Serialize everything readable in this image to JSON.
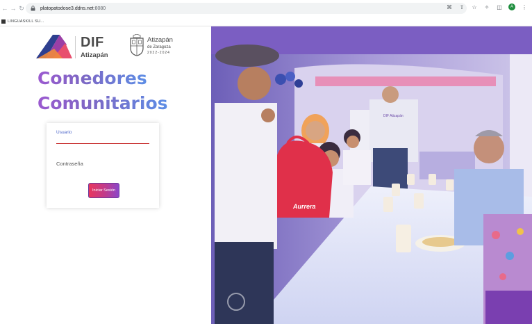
{
  "browser": {
    "url_host": "platopatodose3.ddns.net",
    "url_port": ":8080",
    "bookmark_label": "LINGUASKILL SU...",
    "profile_initial": "A"
  },
  "brand": {
    "dif_title": "DIF",
    "dif_subtitle": "Atizapán",
    "ati_line1": "Atizapán",
    "ati_line2": "de Zaragoza",
    "ati_years": "2022-2024"
  },
  "heading": {
    "line1": "Comedores",
    "line2": "Comunitarios"
  },
  "login": {
    "user_label": "Usuario",
    "pass_label": "Contraseña",
    "button_label": "Iniciar Sesión"
  },
  "photo": {
    "bag_text": "Aurrera",
    "sign_text": "DIF Atizapán"
  },
  "colors": {
    "accent_purple": "#8b47c9",
    "accent_pink": "#e8365d",
    "field_underline": "#c62828",
    "label_blue": "#4a63c8"
  }
}
